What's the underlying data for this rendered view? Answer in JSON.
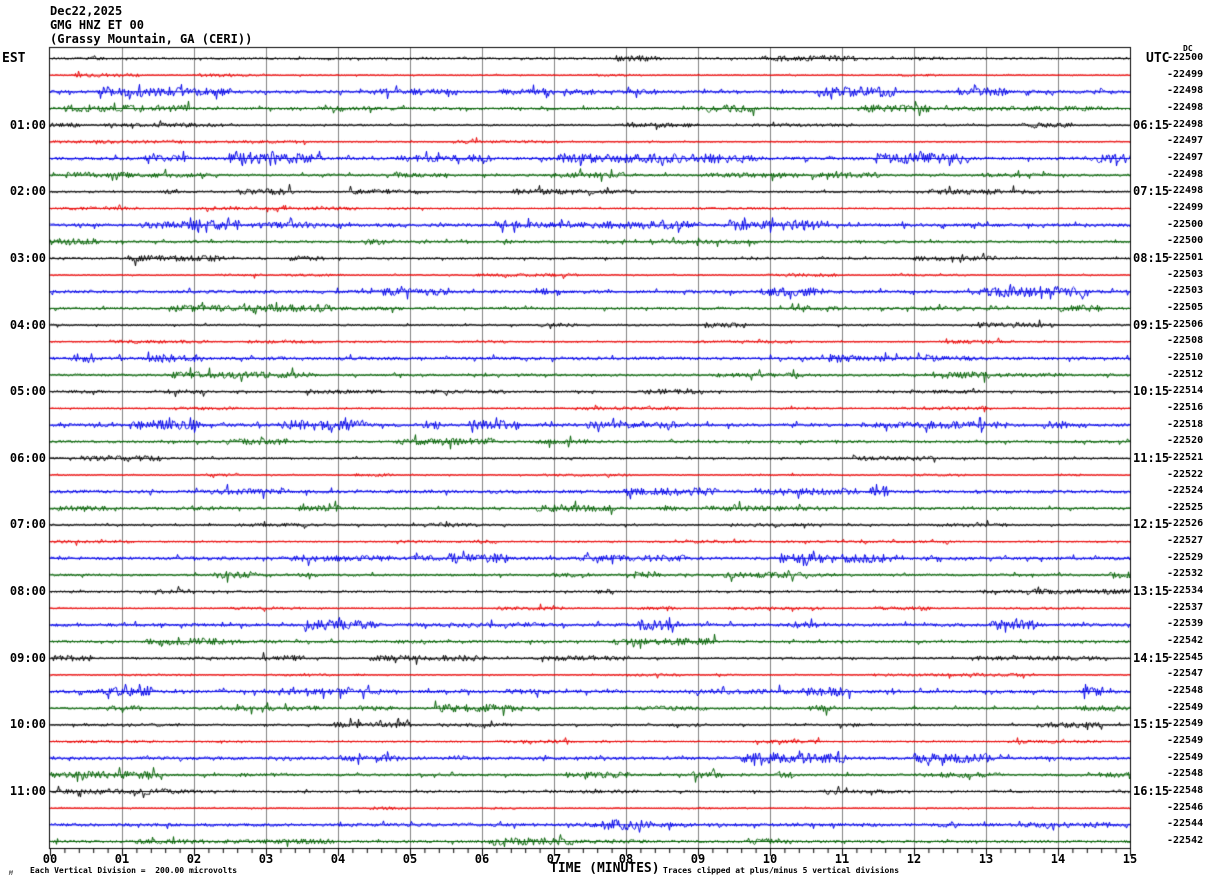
{
  "title": {
    "date": "Dec22,2025",
    "station": "GMG HNZ ET 00",
    "location": "(Grassy Mountain, GA (CERI))"
  },
  "left_axis": {
    "label": "EST",
    "hour_labels": [
      "01:00",
      "02:00",
      "03:00",
      "04:00",
      "05:00",
      "06:00",
      "07:00",
      "08:00",
      "09:00",
      "10:00",
      "11:00"
    ]
  },
  "right_axis": {
    "label": "UTC",
    "dc_header": "DC",
    "hour_labels": [
      "06:15",
      "07:15",
      "08:15",
      "09:15",
      "10:15",
      "11:15",
      "12:15",
      "13:15",
      "14:15",
      "15:15",
      "16:15"
    ],
    "dc_values": [
      -22500,
      -22499,
      -22498,
      -22498,
      -22498,
      -22497,
      -22497,
      -22498,
      -22498,
      -22499,
      -22500,
      -22500,
      -22501,
      -22503,
      -22503,
      -22505,
      -22506,
      -22508,
      -22510,
      -22512,
      -22514,
      -22516,
      -22518,
      -22520,
      -22521,
      -22522,
      -22524,
      -22525,
      -22526,
      -22527,
      -22529,
      -22532,
      -22534,
      -22537,
      -22539,
      -22542,
      -22545,
      -22547,
      -22548,
      -22549,
      -22549,
      -22549,
      -22549,
      -22548,
      -22548,
      -22546,
      -22544,
      -22542
    ]
  },
  "x_axis": {
    "title": "TIME (MINUTES)",
    "tick_labels": [
      "00",
      "01",
      "02",
      "03",
      "04",
      "05",
      "06",
      "07",
      "08",
      "09",
      "10",
      "11",
      "12",
      "13",
      "14",
      "15"
    ]
  },
  "footer": {
    "scale_note": "Each Vertical Division =  200.00 microvolts",
    "clip_note": "Traces clipped at plus/minus 5 vertical divisions",
    "watermark": "M"
  },
  "colors": {
    "trace_cycle": [
      "#000000",
      "#e80000",
      "#0000e8",
      "#006000"
    ],
    "grid": "#808080",
    "border": "#000000"
  },
  "chart_data": {
    "type": "line",
    "subtype": "helicorder-seismogram",
    "title": "Dec22,2025 GMG HNZ ET 00 (Grassy Mountain, GA (CERI))",
    "xlabel": "TIME (MINUTES)",
    "x_range_minutes": [
      0,
      15
    ],
    "x_tick_labels": [
      "00",
      "01",
      "02",
      "03",
      "04",
      "05",
      "06",
      "07",
      "08",
      "09",
      "10",
      "11",
      "12",
      "13",
      "14",
      "15"
    ],
    "minutes_per_line": 15,
    "num_traces": 48,
    "trace_color_cycle": [
      "#000000",
      "#e80000",
      "#0000e8",
      "#006000"
    ],
    "left_time_labels_est": [
      "01:00",
      "02:00",
      "03:00",
      "04:00",
      "05:00",
      "06:00",
      "07:00",
      "08:00",
      "09:00",
      "10:00",
      "11:00"
    ],
    "right_time_labels_utc": [
      "06:15",
      "07:15",
      "08:15",
      "09:15",
      "10:15",
      "11:15",
      "12:15",
      "13:15",
      "14:15",
      "15:15",
      "16:15"
    ],
    "dc_offsets_per_trace": [
      -22500,
      -22499,
      -22498,
      -22498,
      -22498,
      -22497,
      -22497,
      -22498,
      -22498,
      -22499,
      -22500,
      -22500,
      -22501,
      -22503,
      -22503,
      -22505,
      -22506,
      -22508,
      -22510,
      -22512,
      -22514,
      -22516,
      -22518,
      -22520,
      -22521,
      -22522,
      -22524,
      -22525,
      -22526,
      -22527,
      -22529,
      -22532,
      -22534,
      -22537,
      -22539,
      -22542,
      -22545,
      -22547,
      -22548,
      -22549,
      -22549,
      -22549,
      -22549,
      -22548,
      -22548,
      -22546,
      -22544,
      -22542
    ],
    "scale_note": "Each Vertical Division =  200.00 microvolts",
    "clip_note": "Traces clipped at plus/minus 5 vertical divisions",
    "description": "Continuous background seismic noise, no large events; each row is 15 minutes of low-amplitude noise around a flat baseline"
  }
}
